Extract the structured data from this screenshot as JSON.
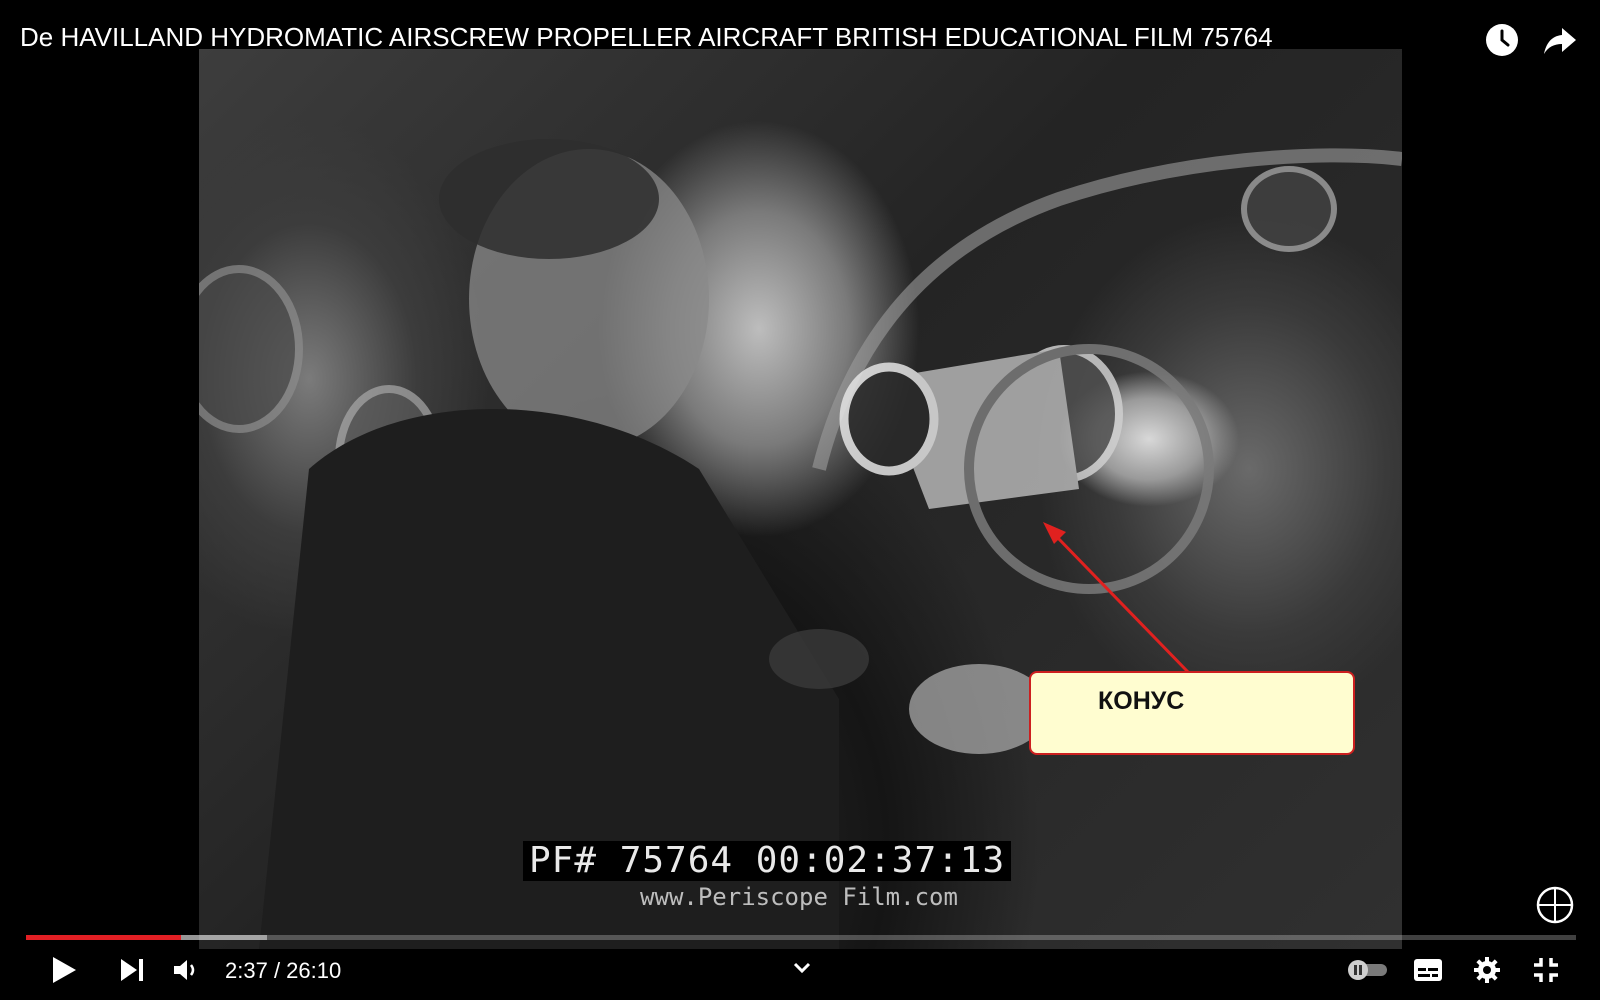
{
  "video": {
    "title": "De HAVILLAND HYDROMATIC AIRSCREW PROPELLER AIRCRAFT BRITISH EDUCATIONAL FILM 75764",
    "timecode": "PF# 75764 00:02:37:13",
    "watermark": "www.Periscope Film.com"
  },
  "annotation": {
    "label": "КОНУС",
    "border_color": "#cc1f1f",
    "fill_color": "#fffdd0"
  },
  "top_actions": [
    {
      "name": "watch-later-icon"
    },
    {
      "name": "share-icon"
    }
  ],
  "player": {
    "current_time": "2:37",
    "separator": " / ",
    "duration": "26:10",
    "progress_fraction": 0.1002,
    "buffered_fraction": 0.1555,
    "accent": "#e21f24"
  },
  "controls": [
    "play-icon",
    "next-icon",
    "volume-icon",
    "chevron-down-icon",
    "autoplay-toggle",
    "subtitles-icon",
    "settings-icon",
    "exit-fullscreen-icon"
  ]
}
